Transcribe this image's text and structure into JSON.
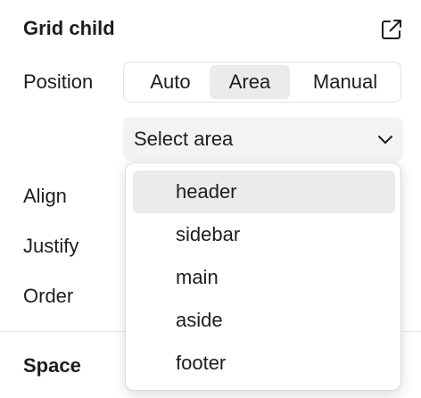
{
  "section": {
    "title": "Grid child"
  },
  "icons": {
    "external": "external-link-icon",
    "chevron": "chevron-down-icon"
  },
  "position": {
    "label": "Position",
    "options": [
      "Auto",
      "Area",
      "Manual"
    ],
    "selected": "Area"
  },
  "area_select": {
    "placeholder": "Select area"
  },
  "rows": {
    "align_label": "Align",
    "justify_label": "Justify",
    "order_label": "Order"
  },
  "dropdown": {
    "options": [
      "header",
      "sidebar",
      "main",
      "aside",
      "footer"
    ],
    "highlighted": "header"
  },
  "space": {
    "title": "Space"
  },
  "colors": {
    "active_segment": "#ebebeb",
    "select_bg": "#f3f3f3",
    "text": "#1d1d1f"
  }
}
